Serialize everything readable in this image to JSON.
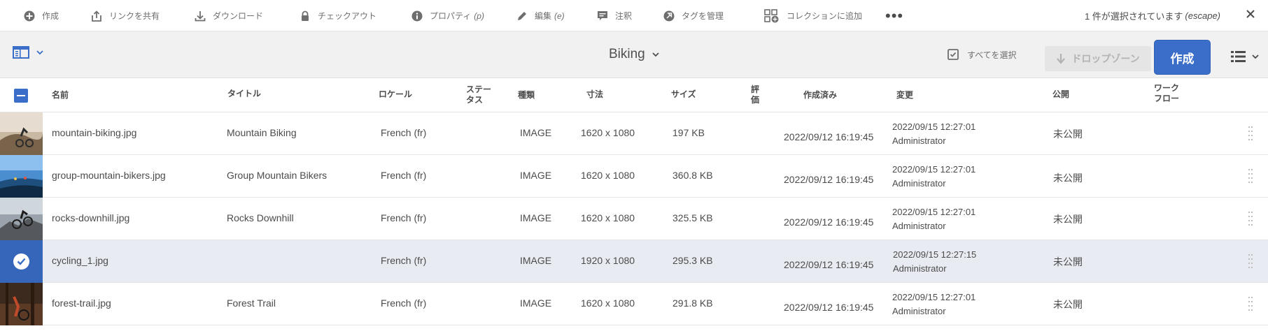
{
  "actionbar": {
    "items": [
      {
        "label": "作成",
        "hotkey": ""
      },
      {
        "label": "リンクを共有",
        "hotkey": ""
      },
      {
        "label": "ダウンロード",
        "hotkey": ""
      },
      {
        "label": "チェックアウト",
        "hotkey": ""
      },
      {
        "label": "プロパティ",
        "hotkey": "(p)"
      },
      {
        "label": "編集",
        "hotkey": "(e)"
      },
      {
        "label": "注釈",
        "hotkey": ""
      },
      {
        "label": "タグを管理",
        "hotkey": ""
      },
      {
        "label": "コレクションに追加",
        "hotkey": ""
      }
    ],
    "more_label": "•••",
    "selection_status": "1 件が選択されています",
    "selection_hotkey": "(escape)"
  },
  "header": {
    "folder_title": "Biking",
    "select_all_label": "すべてを選択",
    "dropzone_label": "ドロップゾーン",
    "create_label": "作成"
  },
  "table": {
    "columns": {
      "name": "名前",
      "title": "タイトル",
      "locale": "ロケール",
      "status_1": "ステー",
      "status_2": "タス",
      "type": "種類",
      "dimensions": "寸法",
      "size": "サイズ",
      "rating_1": "評",
      "rating_2": "価",
      "created": "作成済み",
      "modified": "変更",
      "published": "公開",
      "workflow_1": "ワーク",
      "workflow_2": "フロー"
    },
    "rows": [
      {
        "name": "mountain-biking.jpg",
        "title": "Mountain Biking",
        "locale": "French (fr)",
        "type": "IMAGE",
        "dimensions": "1620 x 1080",
        "size": "197 KB",
        "created": "2022/09/12 16:19:45",
        "modified_date": "2022/09/15 12:27:01",
        "modified_by": "Administrator",
        "published": "未公開",
        "selected": false
      },
      {
        "name": "group-mountain-bikers.jpg",
        "title": "Group Mountain Bikers",
        "locale": "French (fr)",
        "type": "IMAGE",
        "dimensions": "1620 x 1080",
        "size": "360.8 KB",
        "created": "2022/09/12 16:19:45",
        "modified_date": "2022/09/15 12:27:01",
        "modified_by": "Administrator",
        "published": "未公開",
        "selected": false
      },
      {
        "name": "rocks-downhill.jpg",
        "title": "Rocks Downhill",
        "locale": "French (fr)",
        "type": "IMAGE",
        "dimensions": "1620 x 1080",
        "size": "325.5 KB",
        "created": "2022/09/12 16:19:45",
        "modified_date": "2022/09/15 12:27:01",
        "modified_by": "Administrator",
        "published": "未公開",
        "selected": false
      },
      {
        "name": "cycling_1.jpg",
        "title": "",
        "locale": "French (fr)",
        "type": "IMAGE",
        "dimensions": "1920 x 1080",
        "size": "295.3 KB",
        "created": "2022/09/12 16:19:45",
        "modified_date": "2022/09/15 12:27:15",
        "modified_by": "Administrator",
        "published": "未公開",
        "selected": true
      },
      {
        "name": "forest-trail.jpg",
        "title": "Forest Trail",
        "locale": "French (fr)",
        "type": "IMAGE",
        "dimensions": "1620 x 1080",
        "size": "291.8 KB",
        "created": "2022/09/12 16:19:45",
        "modified_date": "2022/09/15 12:27:01",
        "modified_by": "Administrator",
        "published": "未公開",
        "selected": false
      }
    ]
  },
  "colors": {
    "accent": "#3a6ec9",
    "selected_row": "#e8ebf1",
    "header_bg": "#f1f1f1"
  }
}
